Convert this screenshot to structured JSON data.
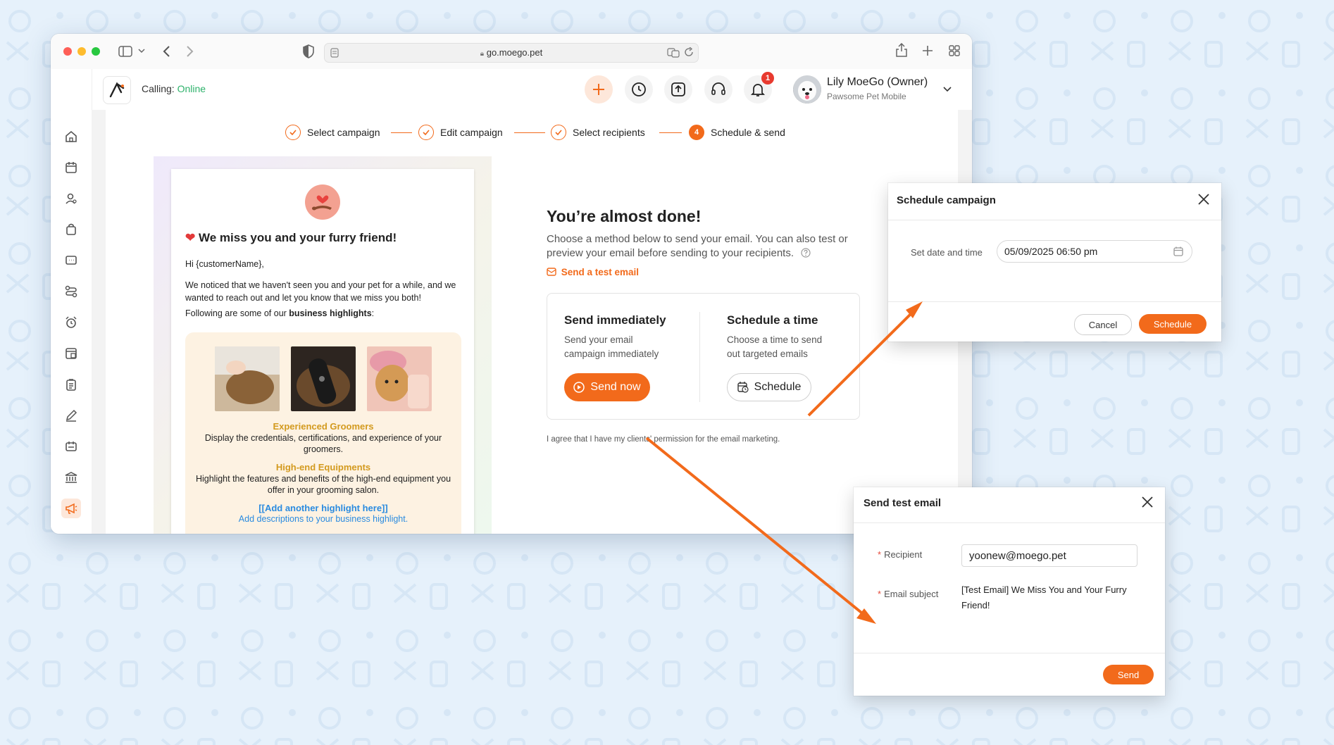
{
  "browser": {
    "url": "go.moego.pet"
  },
  "header": {
    "calling_label": "Calling:",
    "calling_status": "Online",
    "notification_count": "1",
    "user_name": "Lily MoeGo (Owner)",
    "user_business": "Pawsome Pet Mobile"
  },
  "steps": [
    {
      "label": "Select campaign"
    },
    {
      "label": "Edit campaign"
    },
    {
      "label": "Select recipients"
    },
    {
      "label": "Schedule & send",
      "number": "4"
    }
  ],
  "email_preview": {
    "title": "We miss you and your furry friend!",
    "greeting": "Hi {customerName},",
    "paragraph": "We noticed that we haven't seen you and your pet for a while, and we wanted to reach out and let you know that we miss you both!",
    "highlights_intro": "Following are some of our ",
    "highlights_intro_bold": "business highlights",
    "highlights_intro_end": ":",
    "highlights": [
      {
        "title": "Experienced Groomers",
        "description": "Display the credentials, certifications, and experience of your groomers."
      },
      {
        "title": "High-end Equipments",
        "description": "Highlight the features and benefits of the high-end equipment you offer in your grooming salon."
      }
    ],
    "add_highlight_link": "[[Add another highlight here]]",
    "add_highlight_desc": "Add descriptions to your business highlight."
  },
  "main": {
    "title": "You’re almost done!",
    "description": "Choose a method below to send your email. You can also test or preview your email before sending to your recipients.",
    "test_link": "Send a test email",
    "send_immediately": {
      "title": "Send immediately",
      "description": "Send your email campaign immediately",
      "button": "Send now"
    },
    "schedule_time": {
      "title": "Schedule a time",
      "description": "Choose a time to send out targeted emails",
      "button": "Schedule"
    },
    "agree_text": "I agree that I have my clients' permission for the email marketing."
  },
  "schedule_dialog": {
    "title": "Schedule campaign",
    "label": "Set date and time",
    "value": "05/09/2025 06:50 pm",
    "cancel": "Cancel",
    "confirm": "Schedule"
  },
  "test_dialog": {
    "title": "Send test email",
    "recipient_label": "Recipient",
    "recipient_value": "yoonew@moego.pet",
    "subject_label": "Email subject",
    "subject_value": "[Test Email] We Miss You and Your Furry Friend!",
    "send": "Send"
  },
  "colors": {
    "accent": "#f26a1b",
    "online": "#2eb26b",
    "highlight_title": "#d39a1e",
    "link": "#2a8be0",
    "background": "#e6f1fb"
  }
}
